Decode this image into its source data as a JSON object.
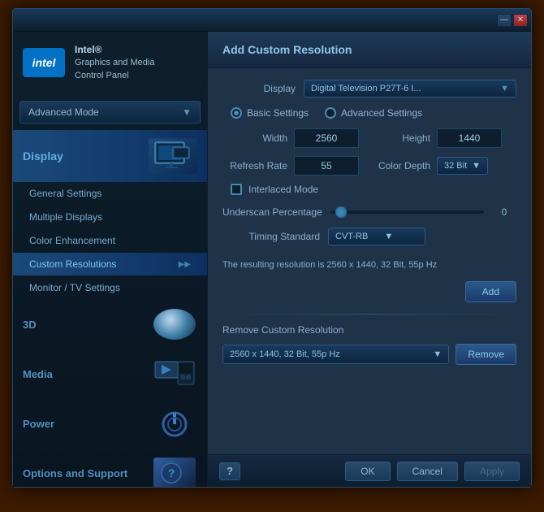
{
  "window": {
    "title": "Intel® Graphics and Media Control Panel",
    "minimize_label": "—",
    "close_label": "✕"
  },
  "sidebar": {
    "intel_logo": "intel",
    "product_name_line1": "Intel®",
    "product_name_line2": "Graphics and Media",
    "product_name_line3": "Control Panel",
    "mode_label": "Advanced Mode",
    "display_nav_label": "Display",
    "nav_items": [
      {
        "label": "General Settings",
        "active": false
      },
      {
        "label": "Multiple Displays",
        "active": false
      },
      {
        "label": "Color Enhancement",
        "active": false
      },
      {
        "label": "Custom Resolutions",
        "active": true
      },
      {
        "label": "Monitor / TV Settings",
        "active": false
      }
    ],
    "main_nav": [
      {
        "label": "3D"
      },
      {
        "label": "Media"
      },
      {
        "label": "Power"
      },
      {
        "label": "Options and Support"
      }
    ]
  },
  "panel": {
    "header": "Add Custom Resolution",
    "display_label": "Display",
    "display_value": "Digital Television P27T-6 I...",
    "basic_settings_label": "Basic Settings",
    "advanced_settings_label": "Advanced Settings",
    "width_label": "Width",
    "width_value": "2560",
    "height_label": "Height",
    "height_value": "1440",
    "refresh_rate_label": "Refresh Rate",
    "refresh_rate_value": "55",
    "color_depth_label": "Color Depth",
    "color_depth_value": "32 Bit",
    "interlaced_label": "Interlaced Mode",
    "underscan_label": "Underscan Percentage",
    "underscan_value": "0",
    "timing_label": "Timing Standard",
    "timing_value": "CVT-RB",
    "result_text": "The resulting resolution is 2560 x 1440, 32 Bit, 55p Hz",
    "add_button_label": "Add",
    "remove_section_label": "Remove Custom Resolution",
    "remove_select_value": "2560 x 1440, 32 Bit, 55p Hz",
    "remove_button_label": "Remove"
  },
  "bottom": {
    "help_label": "?",
    "ok_label": "OK",
    "cancel_label": "Cancel",
    "apply_label": "Apply"
  }
}
